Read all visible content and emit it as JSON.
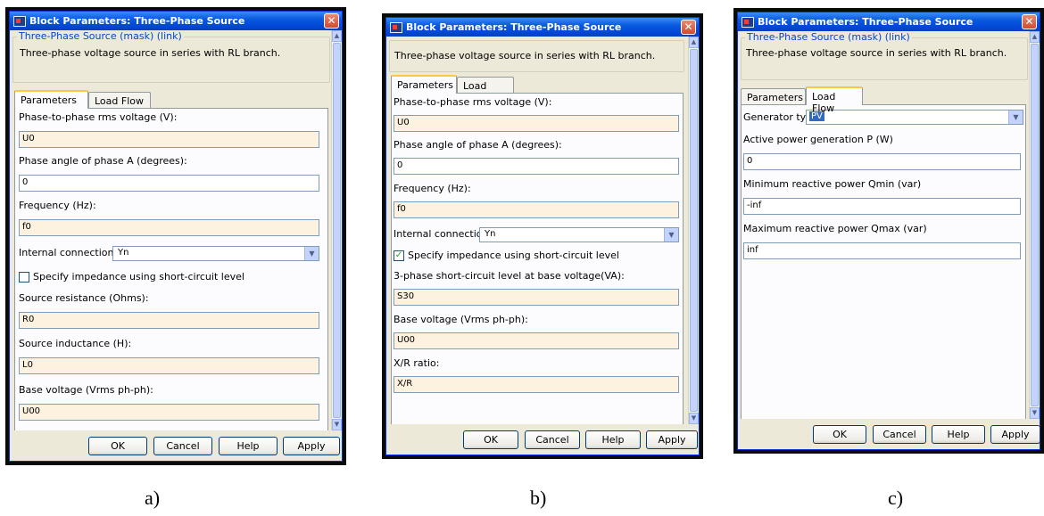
{
  "dialog_title": "Block Parameters: Three-Phase Source",
  "close_glyph": "✕",
  "mask_legend": "Three-Phase Source (mask) (link)",
  "description": "Three-phase voltage source in series with RL branch.",
  "tabs": {
    "parameters": "Parameters",
    "load_flow": "Load Flow"
  },
  "buttons": {
    "ok": "OK",
    "cancel": "Cancel",
    "help": "Help",
    "apply": "Apply"
  },
  "scroll": {
    "up": "▲",
    "down": "▼",
    "dropdown": "▼"
  },
  "check_mark": "✓",
  "panel_a": {
    "caption": "a)",
    "phase_voltage": {
      "label": "Phase-to-phase rms voltage (V):",
      "value": "U0"
    },
    "phase_angle": {
      "label": "Phase angle of phase A (degrees):",
      "value": "0"
    },
    "frequency": {
      "label": "Frequency (Hz):",
      "value": "f0"
    },
    "internal_connection": {
      "label": "Internal connection:",
      "value": "Yn"
    },
    "impedance_checkbox": {
      "label": "Specify impedance using short-circuit level",
      "checked": false
    },
    "source_resistance": {
      "label": "Source resistance (Ohms):",
      "value": "R0"
    },
    "source_inductance": {
      "label": "Source inductance (H):",
      "value": "L0"
    },
    "base_voltage": {
      "label": "Base voltage (Vrms ph-ph):",
      "value": "U00"
    }
  },
  "panel_b": {
    "caption": "b)",
    "phase_voltage": {
      "label": "Phase-to-phase rms voltage (V):",
      "value": "U0"
    },
    "phase_angle": {
      "label": "Phase angle of phase A (degrees):",
      "value": "0"
    },
    "frequency": {
      "label": "Frequency (Hz):",
      "value": "f0"
    },
    "internal_connection": {
      "label": "Internal connection:",
      "value": "Yn"
    },
    "impedance_checkbox": {
      "label": "Specify impedance using short-circuit level",
      "checked": true
    },
    "sc_level": {
      "label": "3-phase short-circuit level at base voltage(VA):",
      "value": "S30"
    },
    "base_voltage": {
      "label": "Base voltage (Vrms ph-ph):",
      "value": "U00"
    },
    "xr_ratio": {
      "label": "X/R ratio:",
      "value": "X/R"
    }
  },
  "panel_c": {
    "caption": "c)",
    "generator_type": {
      "label": "Generator type",
      "value": "PV"
    },
    "active_power": {
      "label": "Active power generation P (W)",
      "value": "0"
    },
    "qmin": {
      "label": "Minimum reactive power Qmin (var)",
      "value": "-inf"
    },
    "qmax": {
      "label": "Maximum reactive power Qmax (var)",
      "value": "inf"
    }
  }
}
